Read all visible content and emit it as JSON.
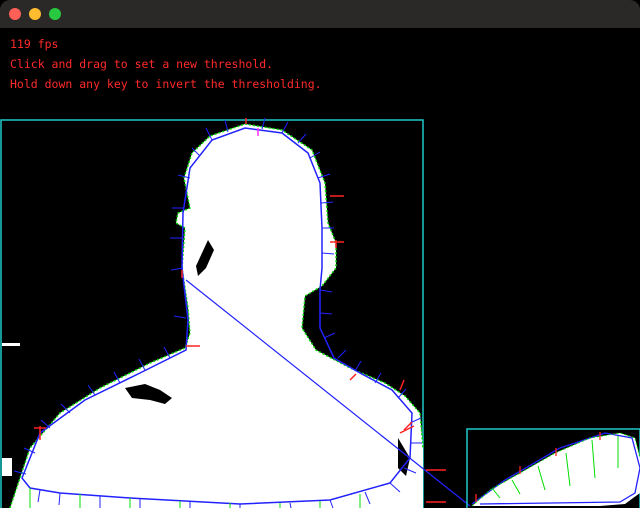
{
  "window": {
    "traffic_lights": [
      {
        "name": "close",
        "color": "#fe5f57"
      },
      {
        "name": "minimize",
        "color": "#febc2e"
      },
      {
        "name": "maximize",
        "color": "#28c840"
      }
    ]
  },
  "hud": {
    "fps": "119 fps",
    "line1": "Click and drag to set a new threshold.",
    "line2": "Hold down any key to invert the thresholding."
  },
  "colors": {
    "text": "#ff2a2a",
    "frame": "#1ec8c8",
    "contour": "#00dd00",
    "hull": "#2222ff",
    "defect": "#ff2222",
    "silhouette": "#ffffff"
  }
}
